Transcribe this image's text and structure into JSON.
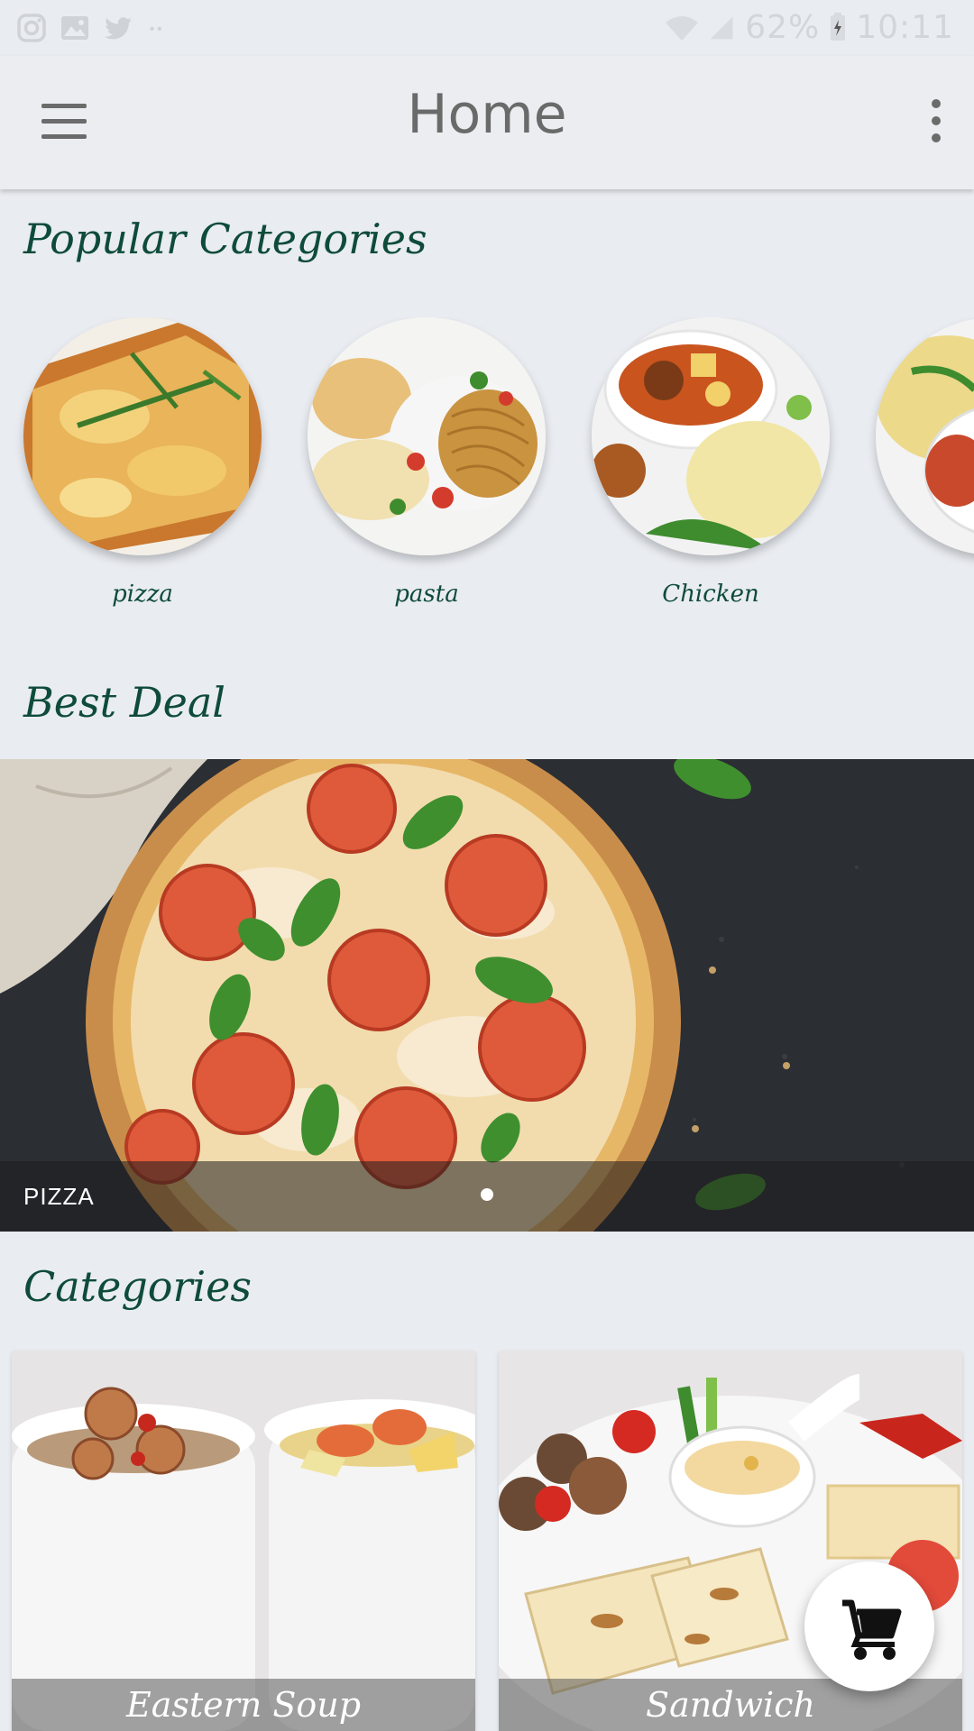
{
  "status_bar": {
    "battery": "62%",
    "time": "10:11",
    "left_icons": [
      "instagram-icon",
      "gallery-icon",
      "twitter-icon",
      "more-dots-icon"
    ],
    "right_icons": [
      "wifi-icon",
      "signal-icon",
      "battery-icon"
    ]
  },
  "app_bar": {
    "title": "Home",
    "menu_icon": "hamburger-menu-icon",
    "overflow_icon": "more-vert-icon"
  },
  "popular": {
    "title": "Popular Categories",
    "items": [
      {
        "label": "pizza"
      },
      {
        "label": "pasta"
      },
      {
        "label": "Chicken"
      },
      {
        "label": ""
      }
    ]
  },
  "best_deal": {
    "title": "Best Deal",
    "slides": [
      {
        "caption": "PIZZA"
      }
    ],
    "active_slide": 1,
    "total_slides": 1
  },
  "categories": {
    "title": "Categories",
    "items": [
      {
        "label": "Eastern Soup"
      },
      {
        "label": "Sandwich"
      }
    ]
  },
  "fab": {
    "icon": "shopping-cart-icon"
  },
  "colors": {
    "background": "#e9ecf1",
    "heading": "#0e4b3a",
    "appbar_text": "#6a6a6a",
    "banner_bg": "#2a2d31"
  }
}
